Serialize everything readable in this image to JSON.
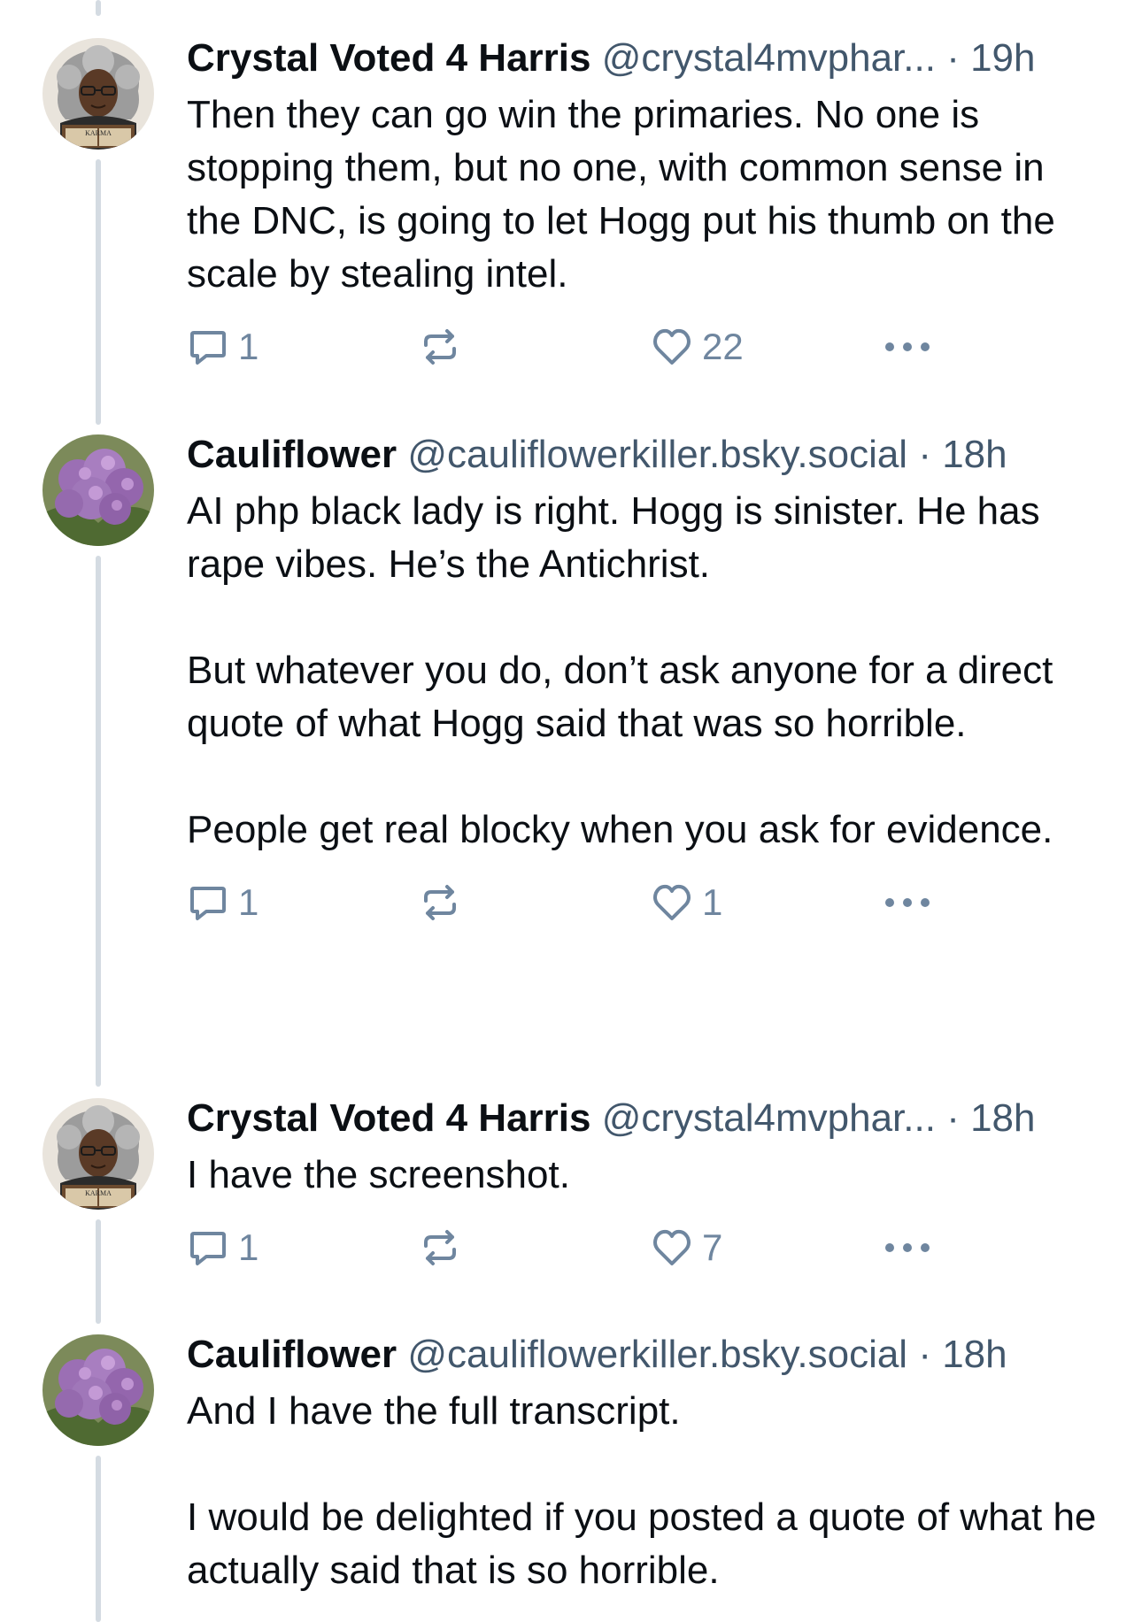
{
  "posts": [
    {
      "author": "Crystal Voted 4 Harris",
      "handle": "@crystal4mvphar...",
      "time": "· 19h",
      "avatar": {
        "icon": "karma-reader-avatar",
        "label": "KARMA"
      },
      "paragraphs": [
        "Then they can go win the primaries. No one is stopping them, but no one, with common sense in the DNC, is going to let Hogg put his thumb on the scale by stealing intel."
      ],
      "replies": "1",
      "reposts": "",
      "likes": "22"
    },
    {
      "author": "Cauliflower",
      "handle": "@cauliflowerkiller.bsky.social",
      "time": "· 18h",
      "avatar": {
        "icon": "cauliflower-avatar"
      },
      "paragraphs": [
        "AI php black lady is right. Hogg is sinister. He has rape vibes. He’s the Antichrist.",
        "But whatever you do, don’t ask anyone for a direct quote of what Hogg said that was so horrible.",
        "People get real blocky when you ask for evidence."
      ],
      "replies": "1",
      "reposts": "",
      "likes": "1"
    },
    {
      "author": "Crystal Voted 4 Harris",
      "handle": "@crystal4mvphar...",
      "time": "· 18h",
      "avatar": {
        "icon": "karma-reader-avatar",
        "label": "KARMA"
      },
      "paragraphs": [
        "I have the screenshot."
      ],
      "replies": "1",
      "reposts": "",
      "likes": "7"
    },
    {
      "author": "Cauliflower",
      "handle": "@cauliflowerkiller.bsky.social",
      "time": "· 18h",
      "avatar": {
        "icon": "cauliflower-avatar"
      },
      "paragraphs": [
        "And I have the full transcript.",
        "I would be delighted if you posted a quote of what he actually said that is so horrible."
      ]
    }
  ],
  "colors": {
    "text": "#0b0f14",
    "muted": "#42576c",
    "icon": "#6f869f",
    "thread_line": "#d4dbe2"
  },
  "icons": {
    "reply": "speech-bubble-icon",
    "repost": "repost-arrows-icon",
    "like": "heart-outline-icon",
    "more": "ellipsis-icon"
  }
}
